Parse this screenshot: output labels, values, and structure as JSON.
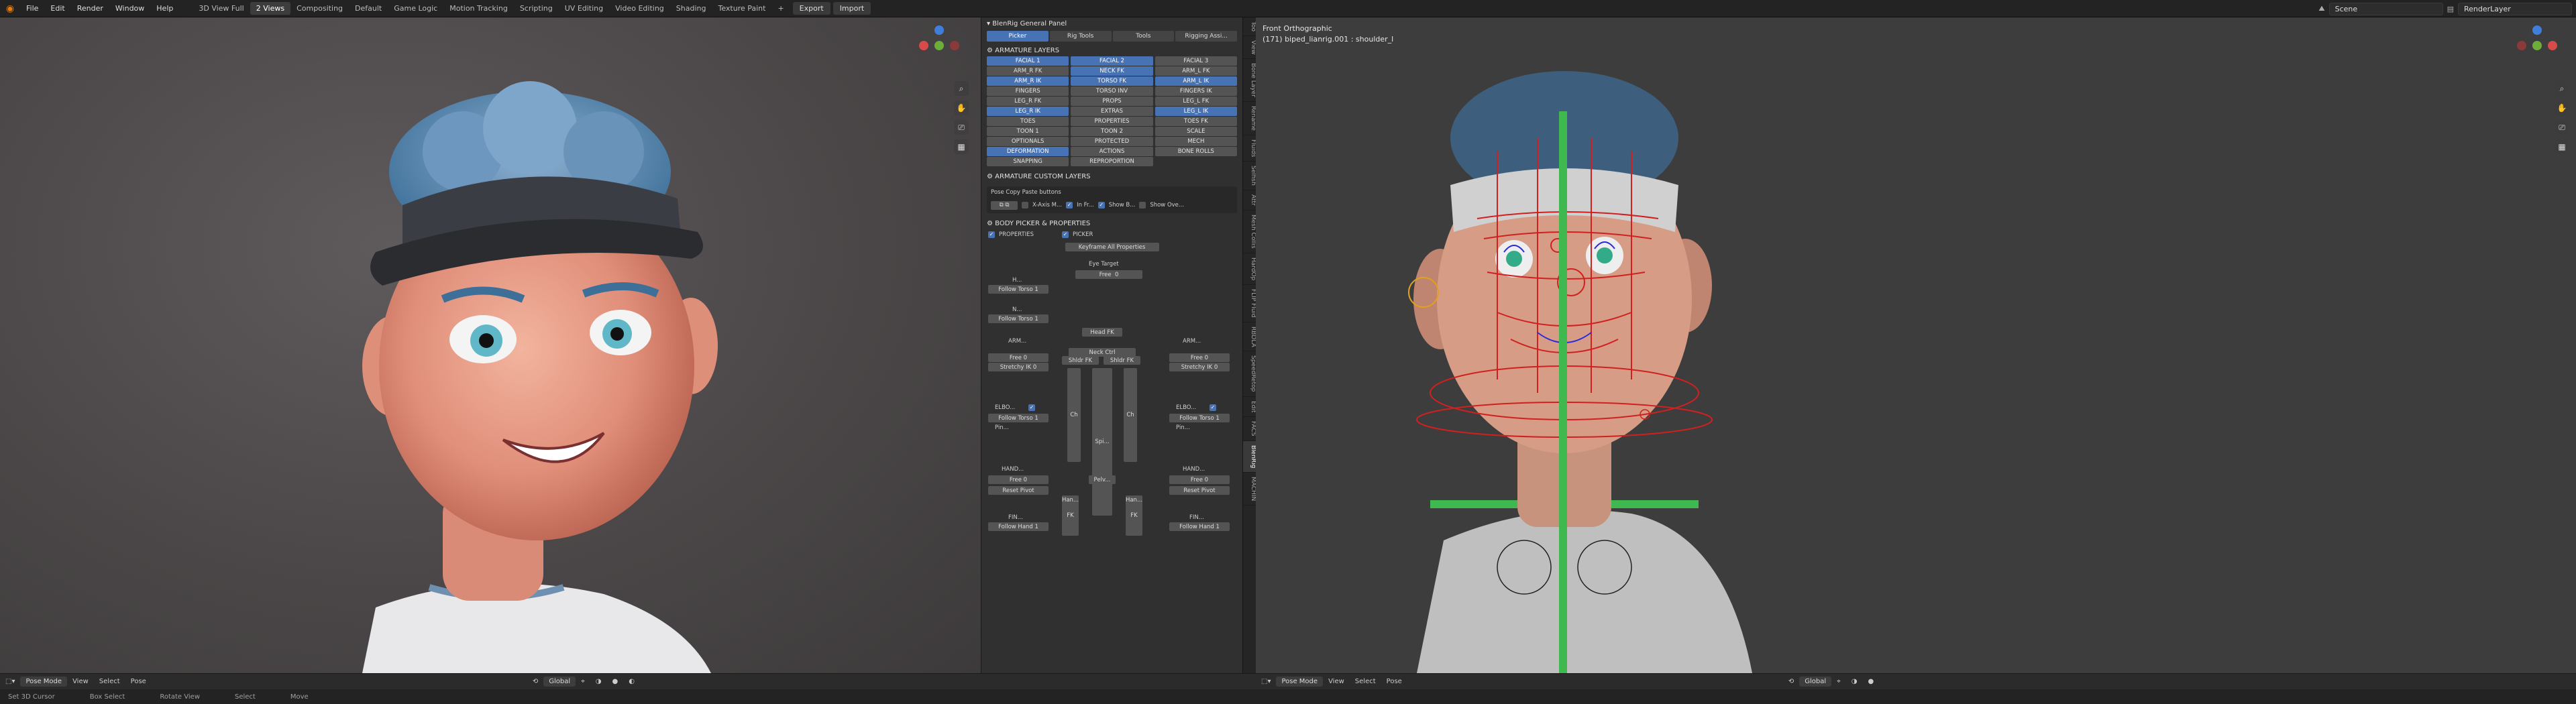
{
  "topbar": {
    "menus": [
      "File",
      "Edit",
      "Render",
      "Window",
      "Help"
    ],
    "workspaces": [
      "3D View Full",
      "2 Views",
      "Compositing",
      "Default",
      "Game Logic",
      "Motion Tracking",
      "Scripting",
      "UV Editing",
      "Video Editing",
      "Shading",
      "Texture Paint"
    ],
    "active_workspace": "2 Views",
    "add": "+",
    "export_label": "Export",
    "import_label": "Import",
    "scene_value": "Scene",
    "renderlayer_value": "RenderLayer"
  },
  "right_viewport": {
    "view_name": "Front Orthographic",
    "info": "(171) biped_lianrig.001 : shoulder_l"
  },
  "sidebar": {
    "panel_title": "BlenRig General Panel",
    "tabs": [
      "Picker",
      "Rig Tools",
      "Tools",
      "Rigging Assi..."
    ],
    "armature_layers_title": "ARMATURE LAYERS",
    "layers": [
      {
        "label": "FACIAL 1",
        "on": true
      },
      {
        "label": "FACIAL 2",
        "on": true
      },
      {
        "label": "FACIAL 3",
        "on": false
      },
      {
        "label": "ARM_R FK",
        "on": false
      },
      {
        "label": "NECK FK",
        "on": true
      },
      {
        "label": "ARM_L FK",
        "on": false
      },
      {
        "label": "ARM_R IK",
        "on": true
      },
      {
        "label": "TORSO FK",
        "on": true
      },
      {
        "label": "ARM_L IK",
        "on": true
      },
      {
        "label": "FINGERS",
        "on": false
      },
      {
        "label": "TORSO INV",
        "on": false
      },
      {
        "label": "FINGERS IK",
        "on": false
      },
      {
        "label": "LEG_R FK",
        "on": false
      },
      {
        "label": "PROPS",
        "on": false
      },
      {
        "label": "LEG_L FK",
        "on": false
      },
      {
        "label": "LEG_R IK",
        "on": true
      },
      {
        "label": "EXTRAS",
        "on": false
      },
      {
        "label": "LEG_L IK",
        "on": true
      },
      {
        "label": "TOES",
        "on": false
      },
      {
        "label": "PROPERTIES",
        "on": false
      },
      {
        "label": "TOES FK",
        "on": false
      },
      {
        "label": "TOON 1",
        "on": false
      },
      {
        "label": "TOON 2",
        "on": false
      },
      {
        "label": "SCALE",
        "on": false
      },
      {
        "label": "OPTIONALS",
        "on": false
      },
      {
        "label": "PROTECTED",
        "on": false
      },
      {
        "label": "MECH",
        "on": false
      },
      {
        "label": "DEFORMATION",
        "on": true
      },
      {
        "label": "ACTIONS",
        "on": false
      },
      {
        "label": "BONE ROLLS",
        "on": false
      },
      {
        "label": "SNAPPING",
        "on": false
      },
      {
        "label": "REPROPORTION",
        "on": false
      }
    ],
    "custom_layers_title": "ARMATURE CUSTOM LAYERS",
    "pose_copy_title": "Pose Copy Paste buttons",
    "pose_opts": [
      "X-Axis M...",
      "In Fr...",
      "Show B...",
      "Show Ove..."
    ],
    "body_picker_title": "BODY PICKER & PROPERTIES",
    "properties_label": "PROPERTIES",
    "picker_label": "PICKER",
    "keyframe_all": "Keyframe All Properties",
    "eye_target": "Eye Target",
    "free_label": "Free",
    "zero": "0",
    "one": "1",
    "follow_torso": "Follow Torso",
    "follow_hand": "Follow Hand",
    "h_label": "H...",
    "n_label": "N...",
    "arm_label": "ARM...",
    "stretchy_ik": "Stretchy IK",
    "elbow_label": "ELBO...",
    "pin_label": "Pin...",
    "hand_label": "HAND...",
    "reset_pivot": "Reset Pivot",
    "fin_label": "FIN...",
    "head_fk": "Head FK",
    "neck_ctrl": "Neck Ctrl",
    "shldr_fk": "Shldr FK",
    "spine": [
      "Spi...",
      "Spi...",
      "Spi..."
    ],
    "pelvis": "Pelv...",
    "fk": "FK",
    "ch": "Ch",
    "han": "Han..."
  },
  "right_tabs": [
    "Too",
    "View",
    "Bone Layer",
    "Rename",
    "Fluids",
    "Selfish",
    "Attr",
    "Mesh Collis",
    "HardOp",
    "FLIP Fluid",
    "RBDLA",
    "SpeedRetop",
    "Edit",
    "FACS",
    "BlenRig",
    "MACHIN"
  ],
  "left_header": {
    "mode": "Pose Mode",
    "menus": [
      "View",
      "Select",
      "Pose"
    ],
    "orientation": "Global"
  },
  "right_header": {
    "mode": "Pose Mode",
    "menus": [
      "View",
      "Select",
      "Pose"
    ],
    "orientation": "Global"
  },
  "status": [
    "Set 3D Cursor",
    "Box Select",
    "Rotate View",
    "Select",
    "Move"
  ],
  "colors": {
    "accent": "#4772b3",
    "blender_orange": "#e87d0d",
    "gizmo_x": "#d94a4a",
    "gizmo_y": "#6dae3a",
    "gizmo_z": "#3f7fd9"
  }
}
